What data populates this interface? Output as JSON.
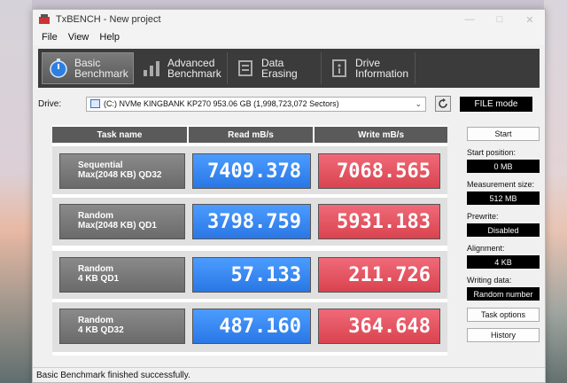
{
  "window": {
    "title": "TxBENCH - New project"
  },
  "menu": [
    "File",
    "View",
    "Help"
  ],
  "toolbar": [
    {
      "label_line1": "Basic",
      "label_line2": "Benchmark",
      "icon": "stopwatch-icon"
    },
    {
      "label_line1": "Advanced",
      "label_line2": "Benchmark",
      "icon": "bar-chart-icon"
    },
    {
      "label_line1": "Data Erasing",
      "label_line2": "",
      "icon": "eraser-icon"
    },
    {
      "label_line1": "Drive",
      "label_line2": "Information",
      "icon": "drive-info-icon"
    }
  ],
  "drive": {
    "label": "Drive:",
    "selected": "(C:) NVMe KINGBANK KP270  953.06 GB (1,998,723,072 Sectors)",
    "mode": "FILE mode"
  },
  "bench": {
    "headers": {
      "task": "Task name",
      "read": "Read mB/s",
      "write": "Write mB/s"
    },
    "rows": [
      {
        "line1": "Sequential",
        "line2": "Max(2048 KB) QD32",
        "read": "7409.378",
        "write": "7068.565"
      },
      {
        "line1": "Random",
        "line2": "Max(2048 KB) QD1",
        "read": "3798.759",
        "write": "5931.183"
      },
      {
        "line1": "Random",
        "line2": "4 KB QD1",
        "read": "57.133",
        "write": "211.726"
      },
      {
        "line1": "Random",
        "line2": "4 KB QD32",
        "read": "487.160",
        "write": "364.648"
      }
    ]
  },
  "side": {
    "start": "Start",
    "start_position_label": "Start position:",
    "start_position": "0 MB",
    "measurement_size_label": "Measurement size:",
    "measurement_size": "512 MB",
    "prewrite_label": "Prewrite:",
    "prewrite": "Disabled",
    "alignment_label": "Alignment:",
    "alignment": "4 KB",
    "writing_data_label": "Writing data:",
    "writing_data": "Random number",
    "task_options": "Task options",
    "history": "History"
  },
  "status": "Basic Benchmark finished successfully."
}
